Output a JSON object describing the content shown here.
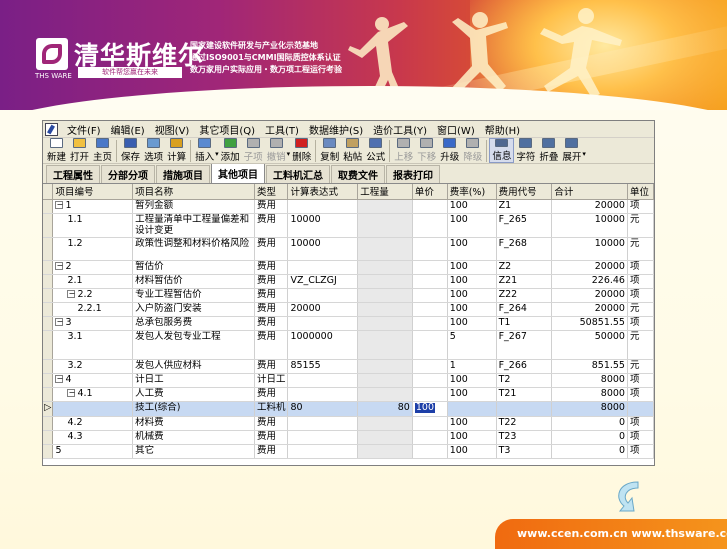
{
  "banner": {
    "brand_name": "清华斯维尔",
    "logo_sub": "THS WARE",
    "slogan": "软件帮您赢在未来",
    "cert_lines": [
      "国家建设软件研发与产业化示范基地",
      "通过ISO9001与CMMI国际质控体系认证",
      "数万家用户实际应用・数万项工程运行考验"
    ],
    "colors": {
      "brand_purple": "#a02678",
      "brand_orange": "#f07018"
    }
  },
  "menu": {
    "items": [
      "文件(F)",
      "编辑(E)",
      "视图(V)",
      "其它项目(Q)",
      "工具(T)",
      "数据维护(S)",
      "造价工具(Y)",
      "窗口(W)",
      "帮助(H)"
    ]
  },
  "toolbar": {
    "buttons": [
      {
        "label": "新建",
        "icon": "new-file-icon",
        "color": "#ffffff"
      },
      {
        "label": "打开",
        "icon": "open-folder-icon",
        "color": "#f0c040"
      },
      {
        "label": "主页",
        "icon": "home-icon",
        "color": "#4a78c8"
      },
      {
        "label": "保存",
        "icon": "save-disk-icon",
        "color": "#3a5fb0"
      },
      {
        "label": "选项",
        "icon": "options-icon",
        "color": "#6a9ad0"
      },
      {
        "label": "计算",
        "icon": "sigma-calc-icon",
        "color": "#d8a020"
      },
      {
        "label": "插入",
        "icon": "insert-icon",
        "color": "#5a8ad0"
      },
      {
        "label": "添加",
        "icon": "add-icon",
        "color": "#40a040"
      },
      {
        "label": "子项",
        "icon": "sub-item-icon",
        "color": "#b0b0b0"
      },
      {
        "label": "撤销",
        "icon": "undo-icon",
        "color": "#b0b0b0"
      },
      {
        "label": "删除",
        "icon": "delete-x-icon",
        "color": "#d02020"
      },
      {
        "label": "复制",
        "icon": "copy-icon",
        "color": "#6a8ac0"
      },
      {
        "label": "粘帖",
        "icon": "paste-icon",
        "color": "#c0a060"
      },
      {
        "label": "公式",
        "icon": "formula-icon",
        "color": "#5070b0"
      },
      {
        "label": "上移",
        "icon": "move-up-icon",
        "color": "#b0b0b0"
      },
      {
        "label": "下移",
        "icon": "move-down-icon",
        "color": "#b0b0b0"
      },
      {
        "label": "升级",
        "icon": "upgrade-arrow-icon",
        "color": "#3a6ac8"
      },
      {
        "label": "降级",
        "icon": "downgrade-arrow-icon",
        "color": "#b0b0b0"
      },
      {
        "label": "信息",
        "icon": "info-icon",
        "color": "#506890"
      },
      {
        "label": "字符",
        "icon": "character-icon",
        "color": "#5070a0"
      },
      {
        "label": "折叠",
        "icon": "collapse-icon",
        "color": "#5070a0"
      },
      {
        "label": "展开",
        "icon": "expand-icon",
        "color": "#5070a0"
      }
    ]
  },
  "tabs": [
    "工程属性",
    "分部分项",
    "措施项目",
    "其他项目",
    "工料机汇总",
    "取费文件",
    "报表打印"
  ],
  "grid": {
    "columns": [
      "项目编号",
      "项目名称",
      "类型",
      "计算表达式",
      "工程量",
      "单价",
      "费率(%)",
      "费用代号",
      "合计",
      "单位"
    ],
    "rows": [
      {
        "code": "1",
        "name": "暂列金额",
        "type": "费用",
        "expr": "",
        "qty": "",
        "price": "",
        "rate": "100",
        "fee_code": "Z1",
        "total": "20000",
        "unit": "项"
      },
      {
        "code": "1.1",
        "name": "工程量清单中工程量偏差和设计变更",
        "type": "费用",
        "expr": "10000",
        "qty": "",
        "price": "",
        "rate": "100",
        "fee_code": "F_265",
        "total": "10000",
        "unit": "元"
      },
      {
        "code": "1.2",
        "name": "政策性调整和材料价格风险",
        "type": "费用",
        "expr": "10000",
        "qty": "",
        "price": "",
        "rate": "100",
        "fee_code": "F_268",
        "total": "10000",
        "unit": "元"
      },
      {
        "code": "2",
        "name": "暂估价",
        "type": "费用",
        "expr": "",
        "qty": "",
        "price": "",
        "rate": "100",
        "fee_code": "Z2",
        "total": "20000",
        "unit": "项"
      },
      {
        "code": "2.1",
        "name": "材料暂估价",
        "type": "费用",
        "expr": "VZ_CLZGJ",
        "qty": "",
        "price": "",
        "rate": "100",
        "fee_code": "Z21",
        "total": "226.46",
        "unit": "项"
      },
      {
        "code": "2.2",
        "name": "专业工程暂估价",
        "type": "费用",
        "expr": "",
        "qty": "",
        "price": "",
        "rate": "100",
        "fee_code": "Z22",
        "total": "20000",
        "unit": "项"
      },
      {
        "code": "2.2.1",
        "name": "入户防盗门安装",
        "type": "费用",
        "expr": "20000",
        "qty": "",
        "price": "",
        "rate": "100",
        "fee_code": "F_264",
        "total": "20000",
        "unit": "元"
      },
      {
        "code": "3",
        "name": "总承包服务费",
        "type": "费用",
        "expr": "",
        "qty": "",
        "price": "",
        "rate": "100",
        "fee_code": "T1",
        "total": "50851.55",
        "unit": "项"
      },
      {
        "code": "3.1",
        "name": "发包人发包专业工程",
        "type": "费用",
        "expr": "1000000",
        "qty": "",
        "price": "",
        "rate": "5",
        "fee_code": "F_267",
        "total": "50000",
        "unit": "元"
      },
      {
        "code": "3.2",
        "name": "发包人供应材料",
        "type": "费用",
        "expr": "85155",
        "qty": "",
        "price": "",
        "rate": "1",
        "fee_code": "F_266",
        "total": "851.55",
        "unit": "元"
      },
      {
        "code": "4",
        "name": "计日工",
        "type": "计日工",
        "expr": "",
        "qty": "",
        "price": "",
        "rate": "100",
        "fee_code": "T2",
        "total": "8000",
        "unit": "项"
      },
      {
        "code": "4.1",
        "name": "人工费",
        "type": "费用",
        "expr": "",
        "qty": "",
        "price": "",
        "rate": "100",
        "fee_code": "T21",
        "total": "8000",
        "unit": "项"
      },
      {
        "code": "",
        "name": "技工(综合)",
        "type": "工料机",
        "expr": "80",
        "qty": "80",
        "price": "100",
        "rate": "",
        "fee_code": "",
        "total": "8000",
        "unit": ""
      },
      {
        "code": "4.2",
        "name": "材料费",
        "type": "费用",
        "expr": "",
        "qty": "",
        "price": "",
        "rate": "100",
        "fee_code": "T22",
        "total": "0",
        "unit": "项"
      },
      {
        "code": "4.3",
        "name": "机械费",
        "type": "费用",
        "expr": "",
        "qty": "",
        "price": "",
        "rate": "100",
        "fee_code": "T23",
        "total": "0",
        "unit": "项"
      },
      {
        "code": "5",
        "name": "其它",
        "type": "费用",
        "expr": "",
        "qty": "",
        "price": "",
        "rate": "100",
        "fee_code": "T3",
        "total": "0",
        "unit": "项"
      }
    ]
  },
  "footer": {
    "text": "www.ccen.com.cn  www.thsware.com"
  }
}
